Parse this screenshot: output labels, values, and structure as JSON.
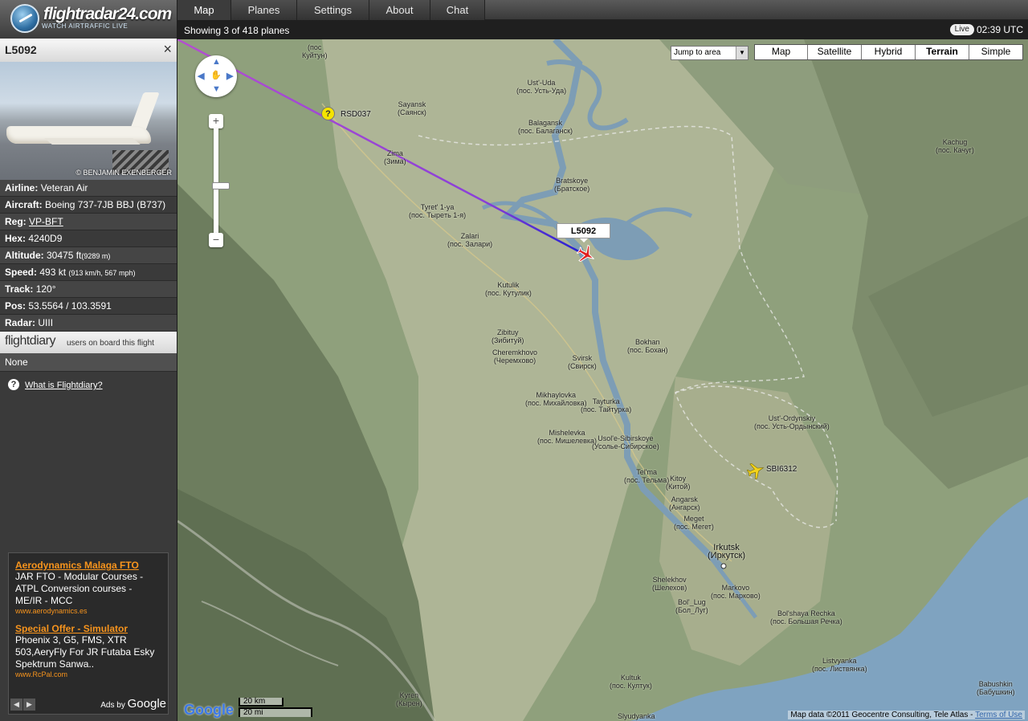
{
  "header": {
    "logo_name": "flightradar24.com",
    "logo_tagline": "WATCH AIRTRAFFIC LIVE",
    "tabs": [
      {
        "label": "Map",
        "active": true
      },
      {
        "label": "Planes"
      },
      {
        "label": "Settings"
      },
      {
        "label": "About"
      },
      {
        "label": "Chat"
      }
    ]
  },
  "status": {
    "planes_showing": "Showing 3 of 418 planes",
    "live_badge": "Live",
    "utc_time": "02:39 UTC"
  },
  "flight": {
    "id": "L5092",
    "close_icon": "×",
    "photo_credit": "© BENJAMIN EXENBERGER",
    "info": [
      {
        "label": "Airline:",
        "value": "Veteran Air"
      },
      {
        "label": "Aircraft:",
        "value": "Boeing 737-7JB BBJ (B737)"
      },
      {
        "label": "Reg:",
        "value": "VP-BFT",
        "link": true
      },
      {
        "label": "Hex:",
        "value": "4240D9"
      },
      {
        "label": "Altitude:",
        "value": "30475 ft",
        "extra": "(9289 m)"
      },
      {
        "label": "Speed:",
        "value": "493 kt",
        "extra": "(913 km/h, 567 mph)"
      },
      {
        "label": "Track:",
        "value": "120°"
      },
      {
        "label": "Pos:",
        "value": "53.5564 / 103.3591"
      },
      {
        "label": "Radar:",
        "value": "UIII"
      }
    ]
  },
  "flightdiary": {
    "logo": "flightdiary",
    "label": "users on board this flight",
    "value": "None",
    "help_icon": "?",
    "help_link": "What is Flightdiary?"
  },
  "ads": {
    "items": [
      {
        "title": "Aerodynamics Malaga FTO",
        "body": "JAR FTO - Modular Courses - ATPL Conversion courses - ME/IR - MCC",
        "url": "www.aerodynamics.es"
      },
      {
        "title": "Special Offer - Simulator",
        "body": "Phoenix 3, G5, FMS, XTR 503,AeryFly For JR Futaba Esky Spektrum Sanwa..",
        "url": "www.RcPal.com"
      }
    ],
    "prev": "◀",
    "next": "▶",
    "ads_by": "Ads by",
    "ads_by_brand": "Google"
  },
  "map": {
    "jump_to": "Jump to area",
    "map_types": [
      {
        "label": "Map"
      },
      {
        "label": "Satellite"
      },
      {
        "label": "Hybrid"
      },
      {
        "label": "Terrain",
        "active": true
      },
      {
        "label": "Simple"
      }
    ],
    "zoom_in": "+",
    "zoom_out": "−",
    "selected_flight_label": "L5092",
    "other_planes": [
      {
        "callsign": "RSD037",
        "status": "warning"
      },
      {
        "callsign": "SBI6312",
        "status": "normal"
      }
    ],
    "warning_icon": "?",
    "places": [
      {
        "name": "(пос",
        "sub": "Куйтун)"
      },
      {
        "name": "Sayansk",
        "sub": "(Саянск)"
      },
      {
        "name": "Zima",
        "sub": "(Зима)"
      },
      {
        "name": "Ust'-Uda",
        "sub": "(пос. Усть-Уда)"
      },
      {
        "name": "Balagansk",
        "sub": "(пос. Балаганск)"
      },
      {
        "name": "Bratskoye",
        "sub": "(Братское)"
      },
      {
        "name": "Kachug",
        "sub": "(пос. Качуг)"
      },
      {
        "name": "Tyret' 1-ya",
        "sub": "(пос. Тырeть 1-я)"
      },
      {
        "name": "Zalari",
        "sub": "(пос. Залари)"
      },
      {
        "name": "Kutulik",
        "sub": "(пос. Кутулик)"
      },
      {
        "name": "Zibituy",
        "sub": "(Зибитуй)"
      },
      {
        "name": "Cheremkhovo",
        "sub": "(Черемхово)"
      },
      {
        "name": "Svirsk",
        "sub": "(Свирск)"
      },
      {
        "name": "Bokhan",
        "sub": "(пос. Бохан)"
      },
      {
        "name": "Mikhaylovka",
        "sub": "(пос. Михайловка)"
      },
      {
        "name": "Tayturka",
        "sub": "(пос. Тайтурка)"
      },
      {
        "name": "Mishelevka",
        "sub": "(пос. Мишелевка)"
      },
      {
        "name": "Usol'e-Sibirskoye",
        "sub": "(Усолье-Сибирское)"
      },
      {
        "name": "Ust'-Ordynskiy",
        "sub": "(пос. Усть-Ордынский)"
      },
      {
        "name": "Tel'ma",
        "sub": "(пос. Тельма)"
      },
      {
        "name": "Kitoy",
        "sub": "(Китой)"
      },
      {
        "name": "Angarsk",
        "sub": "(Ангарск)"
      },
      {
        "name": "Meget",
        "sub": "(пос. Мегет)"
      },
      {
        "name": "Irkutsk",
        "sub": "(Иркутск)"
      },
      {
        "name": "Shelekhov",
        "sub": "(Шелехов)"
      },
      {
        "name": "Markovo",
        "sub": "(пос. Марково)"
      },
      {
        "name": "Bol'_Lug",
        "sub": "(Бол_Луг)"
      },
      {
        "name": "Bol'shaya Rechka",
        "sub": "(пос. Большая Речка)"
      },
      {
        "name": "Listvyanka",
        "sub": "(пос. Листвянка)"
      },
      {
        "name": "Babushkin",
        "sub": "(Бабушкин)"
      },
      {
        "name": "Kultuk",
        "sub": "(пос. Култук)"
      },
      {
        "name": "Kyren",
        "sub": "(Кырен)"
      },
      {
        "name": "Slyudyanka",
        "sub": ""
      }
    ],
    "google": "Google",
    "scale_km": "20 km",
    "scale_mi": "20 mi",
    "attribution": "Map data ©2011 Geocentre Consulting, Tele Atlas -",
    "terms_link": "Terms of Use"
  }
}
